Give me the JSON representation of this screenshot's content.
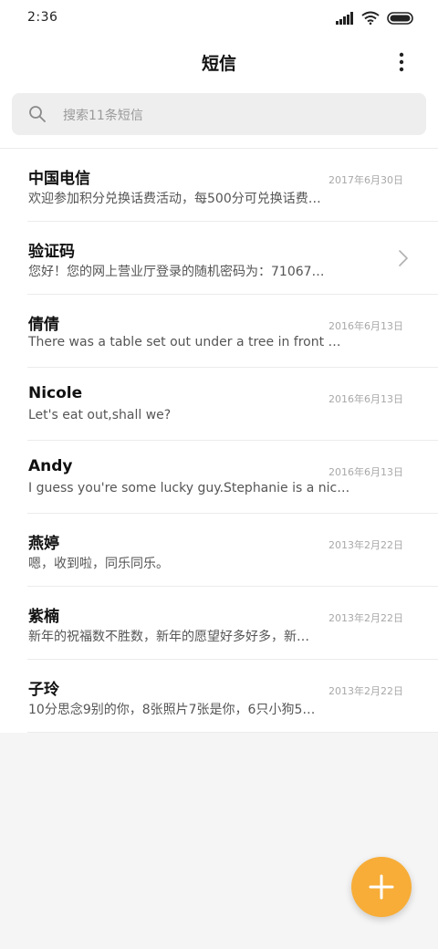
{
  "status_bar": {
    "time": "2:36"
  },
  "header": {
    "title": "短信",
    "more_icon": "more-vertical-icon"
  },
  "search": {
    "placeholder": "搜索11条短信",
    "icon": "search-icon"
  },
  "conversations": [
    {
      "name": "中国电信",
      "date": "2017年6月30日",
      "preview": "欢迎参加积分兑换话费活动，每500分可兑换话费…"
    },
    {
      "name": "验证码",
      "date": "",
      "preview": "您好！您的网上营业厅登录的随机密码为：71067…",
      "chevron": true
    },
    {
      "name": "倩倩",
      "date": "2016年6月13日",
      "preview": "There was a table set out under a tree in front …"
    },
    {
      "name": "Nicole",
      "date": "2016年6月13日",
      "preview": "Let's eat out,shall we?"
    },
    {
      "name": "Andy",
      "date": "2016年6月13日",
      "preview": "I guess you're some lucky guy.Stephanie is a nic…"
    },
    {
      "name": "燕婷",
      "date": "2013年2月22日",
      "preview": "嗯，收到啦，同乐同乐。"
    },
    {
      "name": "紫楠",
      "date": "2013年2月22日",
      "preview": "新年的祝福数不胜数，新年的愿望好多好多，新…"
    },
    {
      "name": "子玲",
      "date": "2013年2月22日",
      "preview": "10分思念9别的你，8张照片7张是你，6只小狗5…"
    }
  ],
  "fab": {
    "icon": "plus-icon"
  },
  "colors": {
    "accent": "#f7ad38",
    "background": "#f5f5f5",
    "surface": "#ffffff",
    "divider": "#ececec"
  }
}
